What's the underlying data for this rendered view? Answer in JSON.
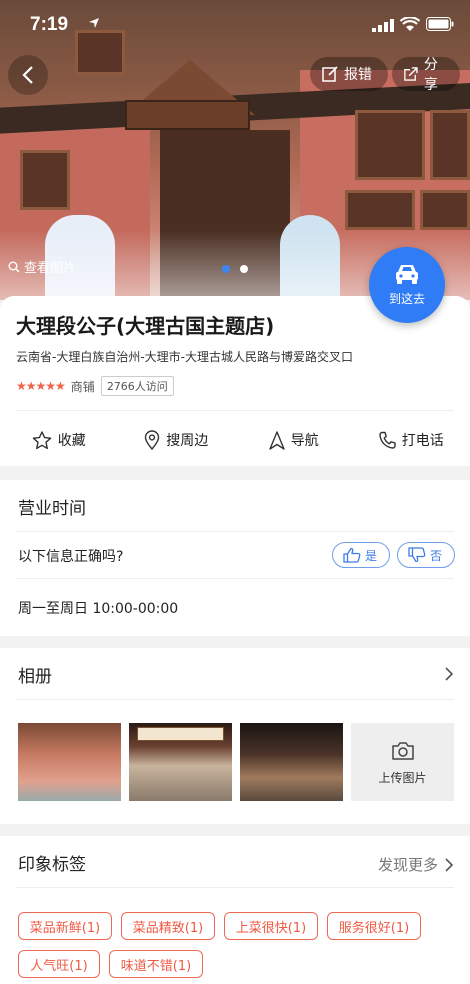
{
  "status_bar": {
    "time": "7:19"
  },
  "header": {
    "report_label": "报错",
    "share_label": "分享"
  },
  "hero": {
    "view_photos_label": "查看图片",
    "carousel_pages": 2,
    "carousel_active": 0
  },
  "go_button": {
    "label": "到这去"
  },
  "place": {
    "name": "大理段公子(大理古国主题店)",
    "address": "云南省-大理白族自治州-大理市-大理古城人民路与博爱路交叉口",
    "rating_stars": 5,
    "category": "商铺",
    "visits": "2766人访问"
  },
  "actions": [
    {
      "label": "收藏",
      "icon": "star-icon"
    },
    {
      "label": "搜周边",
      "icon": "location-pin-icon"
    },
    {
      "label": "导航",
      "icon": "navigation-arrow-icon"
    },
    {
      "label": "打电话",
      "icon": "phone-icon"
    }
  ],
  "hours": {
    "title": "营业时间",
    "question": "以下信息正确吗?",
    "yes_label": "是",
    "no_label": "否",
    "value": "周一至周日 10:00-00:00"
  },
  "album": {
    "title": "相册",
    "upload_label": "上传图片"
  },
  "impressions": {
    "title": "印象标签",
    "more_label": "发现更多",
    "tags": [
      "菜品新鲜(1)",
      "菜品精致(1)",
      "上菜很快(1)",
      "服务很好(1)",
      "人气旺(1)",
      "味道不错(1)"
    ]
  },
  "colors": {
    "accent": "#2f7cf6",
    "tag": "#ef5a45",
    "star": "#f0634a"
  }
}
